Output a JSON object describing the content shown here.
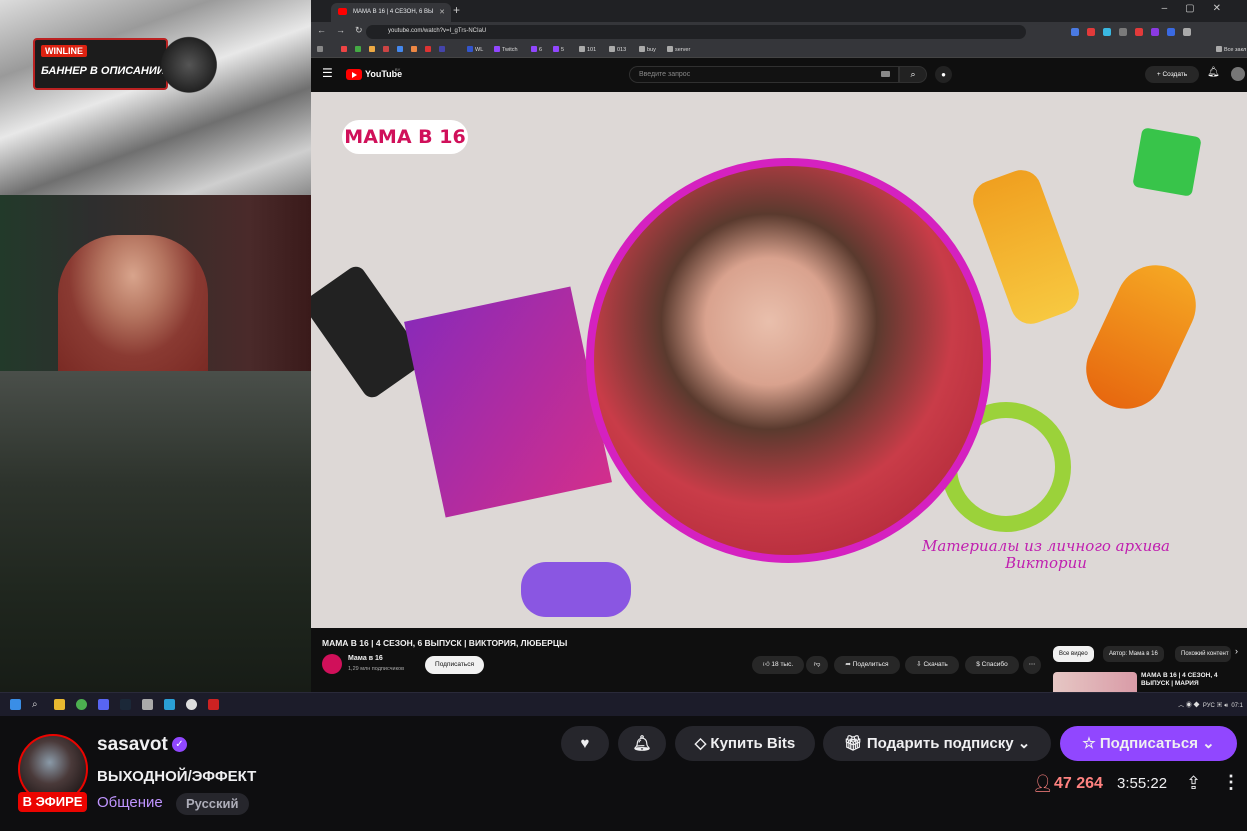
{
  "overlay": {
    "banner_brand": "WINLINE",
    "banner_text": "БАННЕР В ОПИСАНИИ"
  },
  "browser": {
    "tab_title": "МАМА В 16 | 4 СЕЗОН, 6 ВЫ",
    "url": "youtube.com/watch?v=I_gTrs-NCIaU",
    "bookmarks": [
      "WL",
      "Twitch",
      "6",
      "5",
      "101",
      "013",
      "buy",
      "server"
    ],
    "bookmarks_right": "Все закл"
  },
  "youtube": {
    "logo_text": "YouTube",
    "logo_region": "BY",
    "search_placeholder": "Введите запрос",
    "create_label": "Создать",
    "video": {
      "show_logo": "МАМА В 16",
      "caption": "Материалы из личного архива Виктории"
    },
    "title": "МАМА В 16 | 4 СЕЗОН, 6 ВЫПУСК | ВИКТОРИЯ, ЛЮБЕРЦЫ",
    "channel": {
      "name": "Мама в 16",
      "subs": "1,29 млн подписчиков"
    },
    "subscribe_label": "Подписаться",
    "actions": {
      "likes": "18 тыс.",
      "share": "Поделиться",
      "download": "Скачать",
      "thanks": "Спасибо"
    },
    "chips": [
      "Все видео",
      "Автор: Мама в 16",
      "Похожий контент"
    ],
    "rec_title": "МАМА В 16 | 4 СЕЗОН, 4 ВЫПУСК | МАРИЯ"
  },
  "taskbar": {
    "lang": "РУС",
    "time": "07:1"
  },
  "stream": {
    "streamer": "sasavot",
    "live_label": "В ЭФИРЕ",
    "title": "ВЫХОДНОЙ/ЭФФЕКТ",
    "category": "Общение",
    "tag": "Русский",
    "buy_bits": "Купить Bits",
    "gift_sub": "Подарить подписку",
    "subscribe": "Подписаться",
    "viewers": "47 264",
    "uptime": "3:55:22"
  },
  "colors": {
    "twitch_purple": "#9147ff",
    "live_red": "#eb0400",
    "viewers": "#ff8280",
    "yt_red": "#ff0000"
  }
}
